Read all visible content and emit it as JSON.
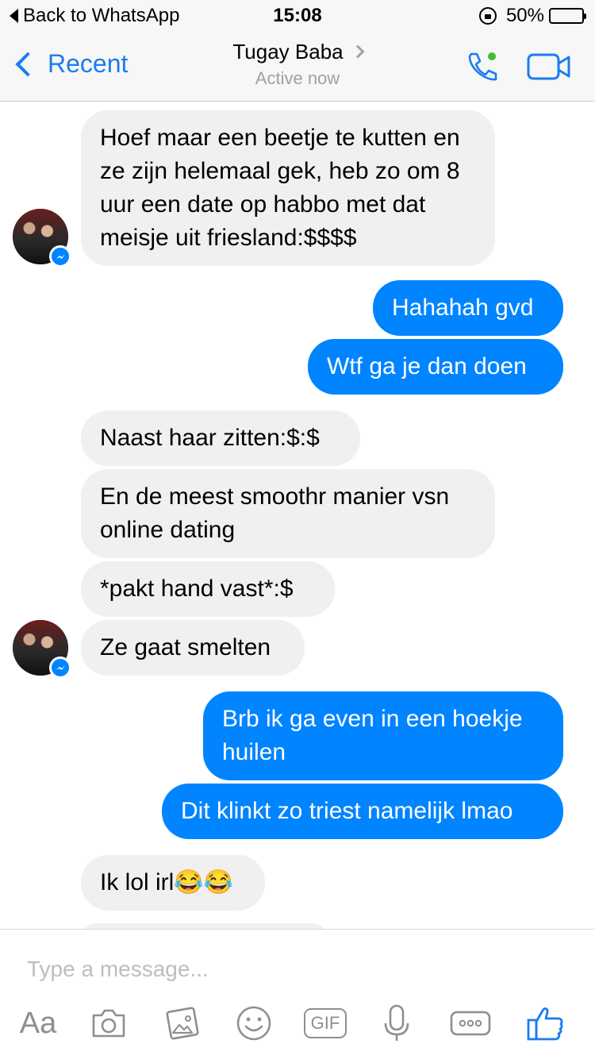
{
  "status_bar": {
    "back_label": "Back to WhatsApp",
    "time": "15:08",
    "battery": "50%",
    "battery_level": 0.5,
    "battery_color": "#f5c518"
  },
  "nav": {
    "back_label": "Recent",
    "contact_name": "Tugay Baba",
    "status": "Active now",
    "accent": "#1a7cf2",
    "online_dot_color": "#44bd32"
  },
  "messages": [
    {
      "from": "them",
      "text": "Hoef maar een beetje te kutten en ze zijn helemaal gek, heb zo om 8 uur een date op habbo met dat meisje uit friesland:$$$$"
    },
    {
      "from": "me",
      "text": "Hahahah gvd"
    },
    {
      "from": "me",
      "text": "Wtf ga je dan doen"
    },
    {
      "from": "them",
      "text": "Naast haar zitten:$:$"
    },
    {
      "from": "them",
      "text": "En de meest smoothr manier vsn online dating"
    },
    {
      "from": "them",
      "text": "*pakt hand vast*:$"
    },
    {
      "from": "them",
      "text": "Ze gaat smelten"
    },
    {
      "from": "me",
      "text": "Brb ik ga even in een hoekje huilen"
    },
    {
      "from": "me",
      "text": "Dit klinkt zo triest namelijk lmao"
    },
    {
      "from": "them",
      "text": "Ik lol irl😂😂"
    }
  ],
  "colors": {
    "incoming_bubble": "#f1f0f0",
    "outgoing_bubble": "#0084ff"
  },
  "composer": {
    "placeholder": "Type a message...",
    "aa_label": "Aa",
    "gif_label": "GIF",
    "icons": [
      "camera-icon",
      "photo-icon",
      "emoji-icon",
      "gif-icon",
      "microphone-icon",
      "more-icon",
      "like-icon"
    ]
  }
}
